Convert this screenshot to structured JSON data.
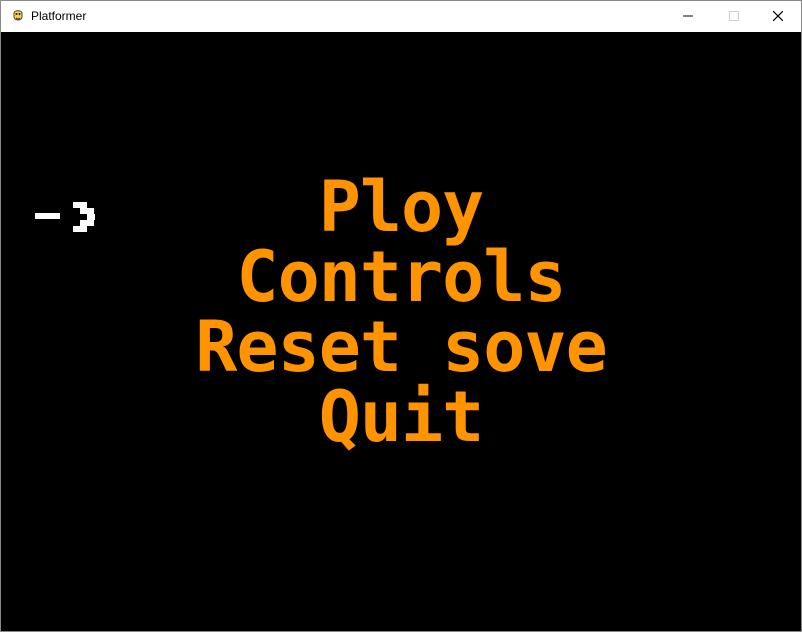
{
  "window": {
    "title": "Platformer",
    "app_icon": "pygame-snake-icon",
    "controls": {
      "minimize": "minimize-icon",
      "maximize": "maximize-icon",
      "close": "close-icon"
    }
  },
  "game": {
    "background_color": "#000000",
    "menu_color": "#ff9400",
    "cursor_color": "#ffffff",
    "selected_index": 0,
    "menu_items": [
      {
        "label": "Ploy"
      },
      {
        "label": "Controls"
      },
      {
        "label": "Reset sove"
      },
      {
        "label": "Quit"
      }
    ]
  }
}
